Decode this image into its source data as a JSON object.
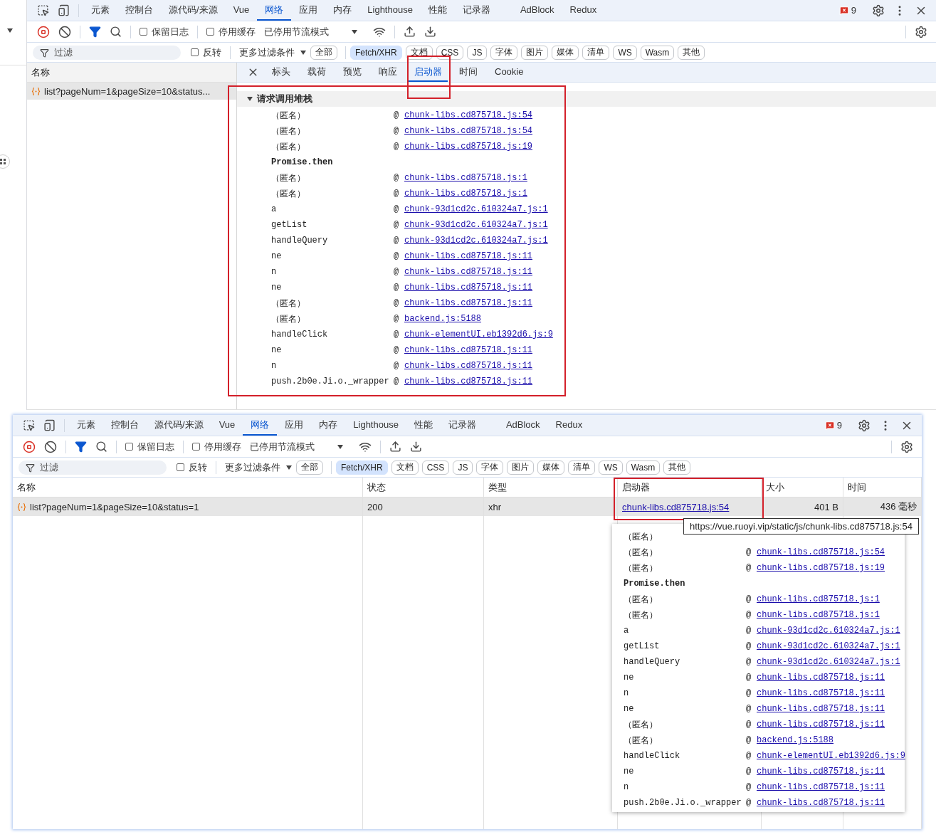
{
  "top_devtools": {
    "main_tabs": [
      {
        "label": "元素",
        "selected": false
      },
      {
        "label": "控制台",
        "selected": false
      },
      {
        "label": "源代码/来源",
        "selected": false
      },
      {
        "label": "Vue",
        "selected": false
      },
      {
        "label": "网络",
        "selected": true
      },
      {
        "label": "应用",
        "selected": false
      },
      {
        "label": "内存",
        "selected": false
      },
      {
        "label": "Lighthouse",
        "selected": false
      },
      {
        "label": "性能",
        "selected": false
      },
      {
        "label": "记录器",
        "selected": false
      },
      {
        "label": "AdBlock",
        "selected": false
      },
      {
        "label": "Redux",
        "selected": false
      }
    ],
    "error_count": "9",
    "toolbar": {
      "preserve_log": {
        "label": "保留日志",
        "checked": false
      },
      "disable_cache": {
        "label": "停用缓存",
        "checked": false
      },
      "throttling": "已停用节流模式"
    },
    "filter": {
      "placeholder": "过滤",
      "invert": {
        "label": "反转",
        "checked": false
      },
      "more_filters": "更多过滤条件",
      "chips": [
        {
          "label": "全部",
          "selected": false
        },
        {
          "label": "Fetch/XHR",
          "selected": true
        },
        {
          "label": "文档",
          "selected": false
        },
        {
          "label": "CSS",
          "selected": false
        },
        {
          "label": "JS",
          "selected": false
        },
        {
          "label": "字体",
          "selected": false
        },
        {
          "label": "图片",
          "selected": false
        },
        {
          "label": "媒体",
          "selected": false
        },
        {
          "label": "清单",
          "selected": false
        },
        {
          "label": "WS",
          "selected": false
        },
        {
          "label": "Wasm",
          "selected": false
        },
        {
          "label": "其他",
          "selected": false
        }
      ]
    },
    "request_list": {
      "header": "名称",
      "rows": [
        {
          "name": "list?pageNum=1&pageSize=10&status...",
          "selected": true
        }
      ]
    },
    "detail_tabs": [
      {
        "label": "标头",
        "selected": false,
        "highlighted": false
      },
      {
        "label": "载荷",
        "selected": false,
        "highlighted": false
      },
      {
        "label": "预览",
        "selected": false,
        "highlighted": false
      },
      {
        "label": "响应",
        "selected": false,
        "highlighted": false
      },
      {
        "label": "启动器",
        "selected": true,
        "highlighted": true
      },
      {
        "label": "时间",
        "selected": false,
        "highlighted": false
      },
      {
        "label": "Cookie",
        "selected": false,
        "highlighted": false
      }
    ],
    "initiator": {
      "title": "请求调用堆栈",
      "expanded": true,
      "highlighted": true,
      "at_sign": "@",
      "frames": [
        {
          "kind": "frame",
          "function": "（匿名）",
          "link": "chunk-libs.cd875718.js:54"
        },
        {
          "kind": "frame",
          "function": "（匿名）",
          "link": "chunk-libs.cd875718.js:54"
        },
        {
          "kind": "frame",
          "function": "（匿名）",
          "link": "chunk-libs.cd875718.js:19"
        },
        {
          "kind": "async",
          "function": "Promise.then"
        },
        {
          "kind": "frame",
          "function": "（匿名）",
          "link": "chunk-libs.cd875718.js:1"
        },
        {
          "kind": "frame",
          "function": "（匿名）",
          "link": "chunk-libs.cd875718.js:1"
        },
        {
          "kind": "frame",
          "function": "a",
          "link": "chunk-93d1cd2c.610324a7.js:1"
        },
        {
          "kind": "frame",
          "function": "getList",
          "link": "chunk-93d1cd2c.610324a7.js:1"
        },
        {
          "kind": "frame",
          "function": "handleQuery",
          "link": "chunk-93d1cd2c.610324a7.js:1"
        },
        {
          "kind": "frame",
          "function": "ne",
          "link": "chunk-libs.cd875718.js:11"
        },
        {
          "kind": "frame",
          "function": "n",
          "link": "chunk-libs.cd875718.js:11"
        },
        {
          "kind": "frame",
          "function": "ne",
          "link": "chunk-libs.cd875718.js:11"
        },
        {
          "kind": "frame",
          "function": "（匿名）",
          "link": "chunk-libs.cd875718.js:11"
        },
        {
          "kind": "frame",
          "function": "（匿名）",
          "link": "backend.js:5188"
        },
        {
          "kind": "frame",
          "function": "handleClick",
          "link": "chunk-elementUI.eb1392d6.js:9"
        },
        {
          "kind": "frame",
          "function": "ne",
          "link": "chunk-libs.cd875718.js:11"
        },
        {
          "kind": "frame",
          "function": "n",
          "link": "chunk-libs.cd875718.js:11"
        },
        {
          "kind": "frame",
          "function": "push.2b0e.Ji.o._wrapper",
          "link": "chunk-libs.cd875718.js:11"
        }
      ]
    }
  },
  "bottom_devtools": {
    "main_tabs": [
      {
        "label": "元素",
        "selected": false
      },
      {
        "label": "控制台",
        "selected": false
      },
      {
        "label": "源代码/来源",
        "selected": false
      },
      {
        "label": "Vue",
        "selected": false
      },
      {
        "label": "网络",
        "selected": true
      },
      {
        "label": "应用",
        "selected": false
      },
      {
        "label": "内存",
        "selected": false
      },
      {
        "label": "Lighthouse",
        "selected": false
      },
      {
        "label": "性能",
        "selected": false
      },
      {
        "label": "记录器",
        "selected": false
      },
      {
        "label": "AdBlock",
        "selected": false
      },
      {
        "label": "Redux",
        "selected": false
      }
    ],
    "error_count": "9",
    "toolbar": {
      "preserve_log": {
        "label": "保留日志",
        "checked": false
      },
      "disable_cache": {
        "label": "停用缓存",
        "checked": false
      },
      "throttling": "已停用节流模式"
    },
    "filter": {
      "placeholder": "过滤",
      "invert": {
        "label": "反转",
        "checked": false
      },
      "more_filters": "更多过滤条件",
      "chips": [
        {
          "label": "全部",
          "selected": false
        },
        {
          "label": "Fetch/XHR",
          "selected": true
        },
        {
          "label": "文档",
          "selected": false
        },
        {
          "label": "CSS",
          "selected": false
        },
        {
          "label": "JS",
          "selected": false
        },
        {
          "label": "字体",
          "selected": false
        },
        {
          "label": "图片",
          "selected": false
        },
        {
          "label": "媒体",
          "selected": false
        },
        {
          "label": "清单",
          "selected": false
        },
        {
          "label": "WS",
          "selected": false
        },
        {
          "label": "Wasm",
          "selected": false
        },
        {
          "label": "其他",
          "selected": false
        }
      ]
    },
    "table": {
      "columns": [
        {
          "label": "名称",
          "highlighted": false
        },
        {
          "label": "状态",
          "highlighted": false
        },
        {
          "label": "类型",
          "highlighted": false
        },
        {
          "label": "启动器",
          "highlighted": true
        },
        {
          "label": "大小",
          "highlighted": false
        },
        {
          "label": "时间",
          "highlighted": false
        }
      ],
      "rows": [
        {
          "selected": true,
          "cells": [
            "list?pageNum=1&pageSize=10&status=1",
            "200",
            "xhr",
            "chunk-libs.cd875718.js:54",
            "401 B",
            "436 毫秒"
          ]
        }
      ]
    },
    "tooltip": "https://vue.ruoyi.vip/static/js/chunk-libs.cd875718.js:54",
    "at_sign": "@",
    "popup": {
      "frames": [
        {
          "kind": "frame",
          "function": "（匿名）"
        },
        {
          "kind": "frame",
          "function": "（匿名）",
          "link": "chunk-libs.cd875718.js:54"
        },
        {
          "kind": "frame",
          "function": "（匿名）",
          "link": "chunk-libs.cd875718.js:19"
        },
        {
          "kind": "async",
          "function": "Promise.then"
        },
        {
          "kind": "frame",
          "function": "（匿名）",
          "link": "chunk-libs.cd875718.js:1"
        },
        {
          "kind": "frame",
          "function": "（匿名）",
          "link": "chunk-libs.cd875718.js:1"
        },
        {
          "kind": "frame",
          "function": "a",
          "link": "chunk-93d1cd2c.610324a7.js:1"
        },
        {
          "kind": "frame",
          "function": "getList",
          "link": "chunk-93d1cd2c.610324a7.js:1"
        },
        {
          "kind": "frame",
          "function": "handleQuery",
          "link": "chunk-93d1cd2c.610324a7.js:1"
        },
        {
          "kind": "frame",
          "function": "ne",
          "link": "chunk-libs.cd875718.js:11"
        },
        {
          "kind": "frame",
          "function": "n",
          "link": "chunk-libs.cd875718.js:11"
        },
        {
          "kind": "frame",
          "function": "ne",
          "link": "chunk-libs.cd875718.js:11"
        },
        {
          "kind": "frame",
          "function": "（匿名）",
          "link": "chunk-libs.cd875718.js:11"
        },
        {
          "kind": "frame",
          "function": "（匿名）",
          "link": "backend.js:5188"
        },
        {
          "kind": "frame",
          "function": "handleClick",
          "link": "chunk-elementUI.eb1392d6.js:9"
        },
        {
          "kind": "frame",
          "function": "ne",
          "link": "chunk-libs.cd875718.js:11"
        },
        {
          "kind": "frame",
          "function": "n",
          "link": "chunk-libs.cd875718.js:11"
        },
        {
          "kind": "frame",
          "function": "push.2b0e.Ji.o._wrapper",
          "link": "chunk-libs.cd875718.js:11"
        }
      ]
    }
  }
}
